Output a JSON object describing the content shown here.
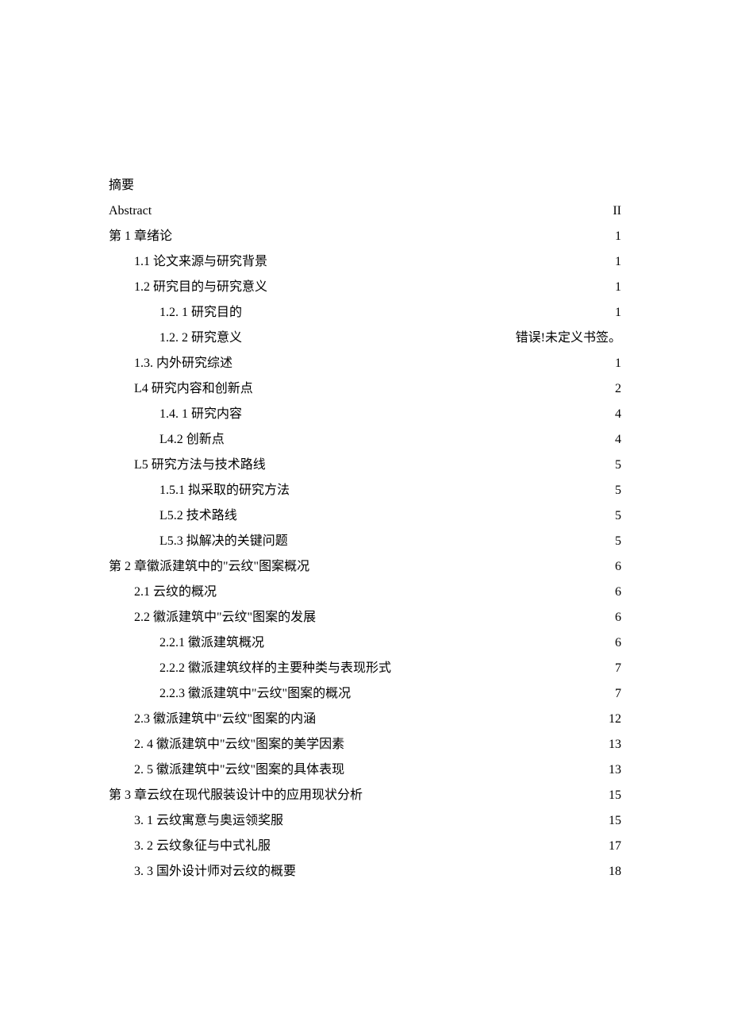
{
  "toc": [
    {
      "label": "摘要",
      "page": "",
      "level": 0,
      "leader": "dots"
    },
    {
      "label": "Abstract ",
      "page": "II",
      "level": 0,
      "leader": "alt"
    },
    {
      "label": "第 1 章绪论 ",
      "page": " 1",
      "level": 0,
      "leader": "dots"
    },
    {
      "label": "1.1   论文来源与研究背景 ",
      "page": " 1",
      "level": 1,
      "leader": "dots"
    },
    {
      "label": "1.2   研究目的与研究意义",
      "page": " 1",
      "level": 1,
      "leader": "dots"
    },
    {
      "label": "1.2.  1 研究目的",
      "page": " 1",
      "level": 2,
      "leader": "dots"
    },
    {
      "label": "1.2.  2 研究意义",
      "page": " 错误!未定义书签。",
      "level": 2,
      "leader": "dots"
    },
    {
      "label": "1.3.   内外研究综述 ",
      "page": " 1",
      "level": 1,
      "leader": "dots"
    },
    {
      "label": "L4 研究内容和创新点",
      "page": " 2",
      "level": 1,
      "leader": "dots"
    },
    {
      "label": "1.4.  1 研究内容 ",
      "page": " 4",
      "level": 2,
      "leader": "dots"
    },
    {
      "label": "L4.2 创新点 ",
      "page": " 4",
      "level": 2,
      "leader": "dots"
    },
    {
      "label": "L5 研究方法与技术路线",
      "page": " 5",
      "level": 1,
      "leader": "dots"
    },
    {
      "label": "1.5.1 拟采取的研究方法",
      "page": " 5",
      "level": 2,
      "leader": "dots"
    },
    {
      "label": "L5.2 技术路线 ",
      "page": " 5",
      "level": 2,
      "leader": "dots"
    },
    {
      "label": "L5.3 拟解决的关键问题 ",
      "page": " 5",
      "level": 2,
      "leader": "dots"
    },
    {
      "label": "第 2 章徽派建筑中的\"云纹\"图案概况 ",
      "page": " 6",
      "level": 0,
      "leader": "dots"
    },
    {
      "label": "2.1 云纹的概况 ",
      "page": " 6",
      "level": 1,
      "leader": "dots"
    },
    {
      "label": "2.2 徽派建筑中\"云纹\"图案的发展 ",
      "page": " 6",
      "level": 1,
      "leader": "dots"
    },
    {
      "label": "2.2.1 徽派建筑概况",
      "page": " 6",
      "level": 2,
      "leader": "dots"
    },
    {
      "label": "2.2.2 徽派建筑纹样的主要种类与表现形式",
      "page": " 7",
      "level": 2,
      "leader": "dots"
    },
    {
      "label": "2.2.3 徽派建筑中\"云纹\"图案的概况",
      "page": " 7",
      "level": 2,
      "leader": "dots"
    },
    {
      "label": "2.3 徽派建筑中\"云纹\"图案的内涵 ",
      "page": " 12",
      "level": 1,
      "leader": "dots"
    },
    {
      "label": "2.  4 徽派建筑中\"云纹\"图案的美学因素",
      "page": " 13",
      "level": 1,
      "leader": "dots"
    },
    {
      "label": "2.  5 徽派建筑中\"云纹\"图案的具体表现",
      "page": " 13",
      "level": 1,
      "leader": "dots"
    },
    {
      "label": "第 3 章云纹在现代服装设计中的应用现状分析 ",
      "page": " 15",
      "level": 0,
      "leader": "dots"
    },
    {
      "label": "3.  1 云纹寓意与奥运领奖服",
      "page": " 15",
      "level": 1,
      "leader": "dots"
    },
    {
      "label": "3.  2 云纹象征与中式礼服",
      "page": " 17",
      "level": 1,
      "leader": "dots"
    },
    {
      "label": "3.  3 国外设计师对云纹的概要",
      "page": " 18",
      "level": 1,
      "leader": "dots"
    }
  ]
}
